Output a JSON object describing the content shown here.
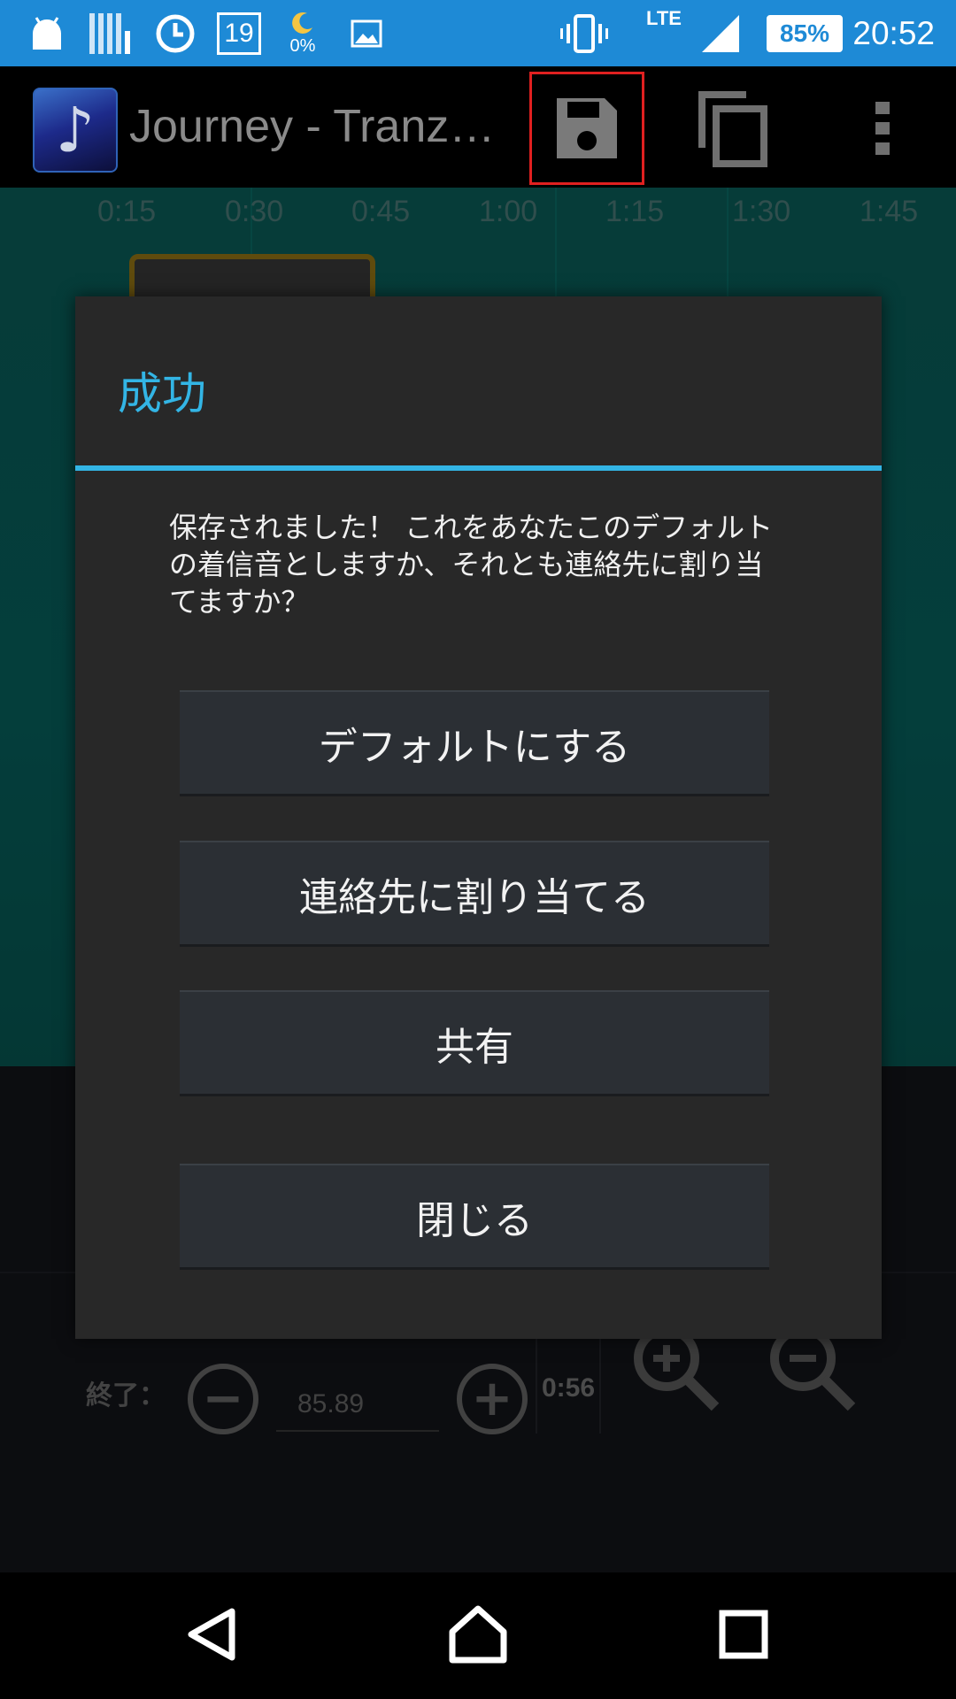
{
  "status_bar": {
    "calendar_day": "19",
    "weather_percent": "0%",
    "network": "LTE",
    "battery": "85%",
    "time": "20:52",
    "icons": [
      "android-icon",
      "bars-icon",
      "clock-icon",
      "calendar-icon",
      "moon-icon",
      "image-icon",
      "vibrate-icon",
      "signal-icon",
      "battery-icon"
    ]
  },
  "action_bar": {
    "title": "Journey - Tranz…",
    "icons": [
      "music-note-icon",
      "save-icon",
      "copy-icon",
      "overflow-menu-icon"
    ],
    "highlight_color": "#e02020"
  },
  "timeline": {
    "ticks": [
      "0:15",
      "0:30",
      "0:45",
      "1:00",
      "1:15",
      "1:30",
      "1:45"
    ]
  },
  "controls": {
    "end_label": "終了：",
    "end_value": "85.89",
    "duration": "0:56",
    "icons": [
      "minus-icon",
      "plus-icon",
      "zoom-in-icon",
      "zoom-out-icon"
    ]
  },
  "dialog": {
    "title": "成功",
    "message": "保存されました！ これをあなたこのデフォルトの着信音としますか、それとも連絡先に割り当てますか？",
    "buttons": {
      "default": "デフォルトにする",
      "assign": "連絡先に割り当てる",
      "share": "共有",
      "close": "閉じる"
    },
    "accent_color": "#33b5e5"
  },
  "nav_bar": {
    "icons": [
      "back-icon",
      "home-icon",
      "recents-icon"
    ]
  }
}
